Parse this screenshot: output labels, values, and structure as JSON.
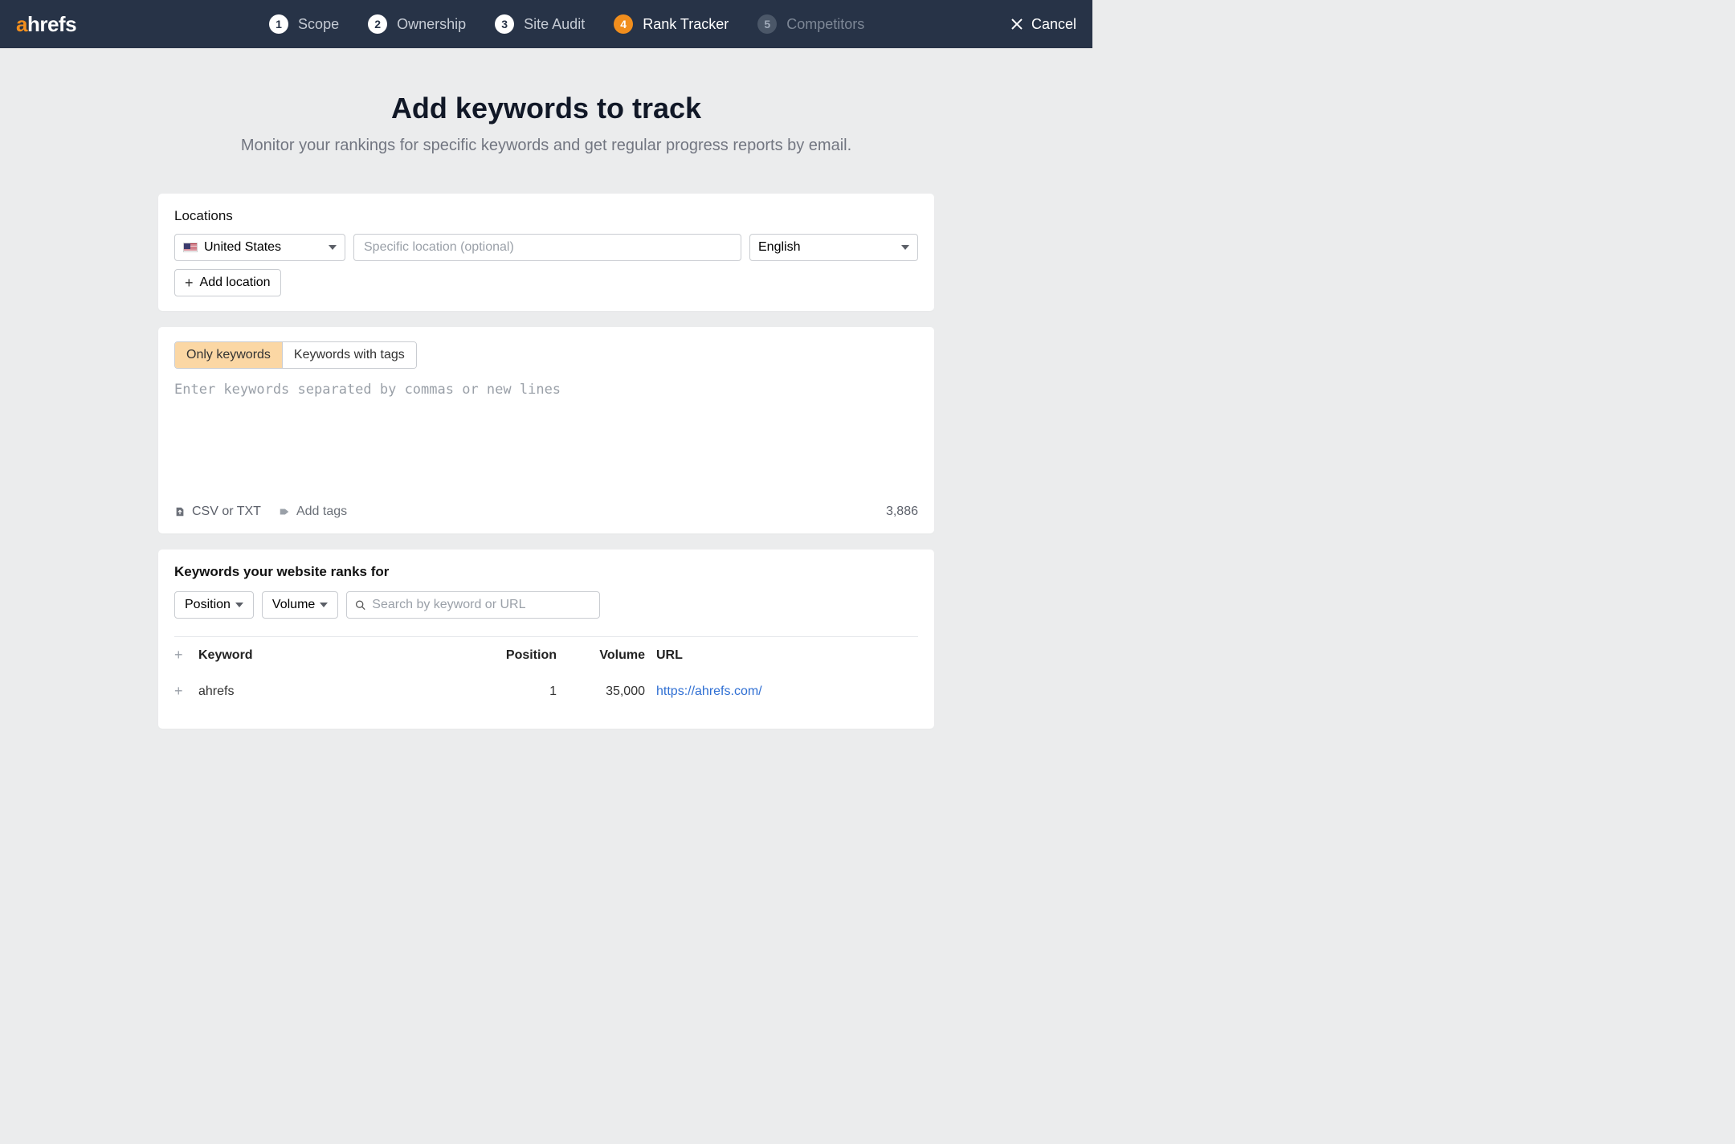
{
  "brand": {
    "a": "a",
    "rest": "hrefs"
  },
  "header": {
    "steps": [
      {
        "num": "1",
        "label": "Scope",
        "state": "done"
      },
      {
        "num": "2",
        "label": "Ownership",
        "state": "done"
      },
      {
        "num": "3",
        "label": "Site Audit",
        "state": "done"
      },
      {
        "num": "4",
        "label": "Rank Tracker",
        "state": "active"
      },
      {
        "num": "5",
        "label": "Competitors",
        "state": "future"
      }
    ],
    "cancel": "Cancel"
  },
  "page": {
    "title": "Add keywords to track",
    "subtitle": "Monitor your rankings for specific keywords and get regular progress reports by email."
  },
  "locations": {
    "section_label": "Locations",
    "country": "United States",
    "specific_placeholder": "Specific location (optional)",
    "language": "English",
    "add_location": "Add location"
  },
  "keywords": {
    "toggle": {
      "only": "Only keywords",
      "tags": "Keywords with tags"
    },
    "textarea_placeholder": "Enter keywords separated by commas or new lines",
    "footer": {
      "csv": "CSV or TXT",
      "add_tags": "Add tags",
      "count": "3,886"
    }
  },
  "ranks": {
    "title": "Keywords your website ranks for",
    "filters": {
      "position": "Position",
      "volume": "Volume",
      "search_placeholder": "Search by keyword or URL"
    },
    "columns": {
      "keyword": "Keyword",
      "position": "Position",
      "volume": "Volume",
      "url": "URL"
    },
    "rows": [
      {
        "keyword": "ahrefs",
        "position": "1",
        "volume": "35,000",
        "url": "https://ahrefs.com/"
      }
    ]
  }
}
